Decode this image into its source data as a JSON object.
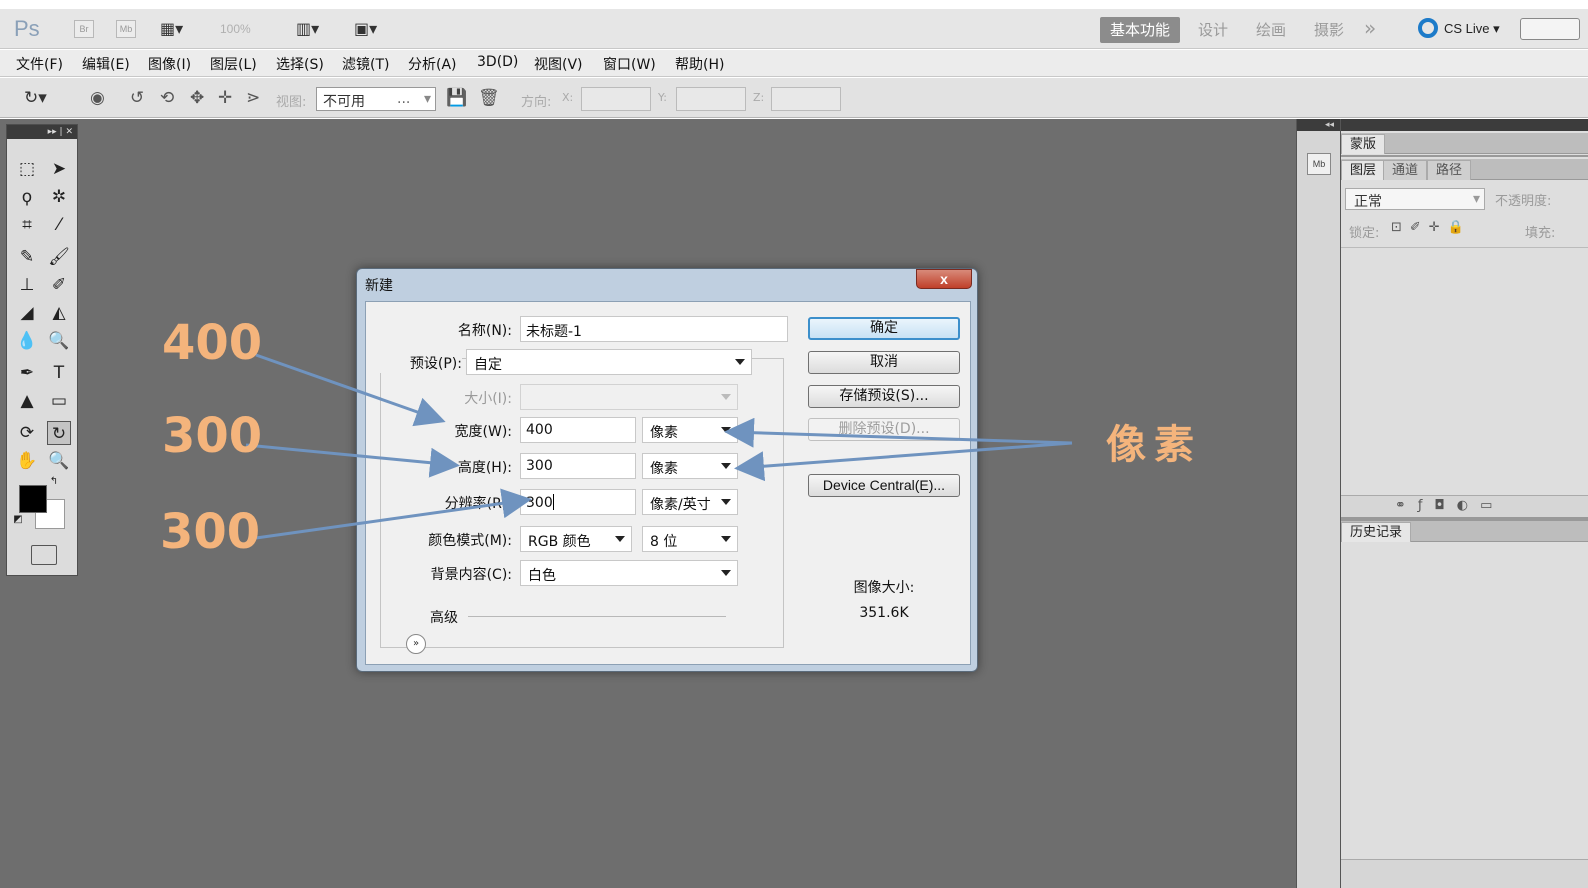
{
  "appbar": {
    "logo": "Ps",
    "bridge": "Br",
    "minibridge": "Mb",
    "zoom": "100%",
    "workspaces": [
      "基本功能",
      "设计",
      "绘画",
      "摄影"
    ],
    "more": "»",
    "cslive": "CS Live"
  },
  "menu": [
    "文件(F)",
    "编辑(E)",
    "图像(I)",
    "图层(L)",
    "选择(S)",
    "滤镜(T)",
    "分析(A)",
    "3D(D)",
    "视图(V)",
    "窗口(W)",
    "帮助(H)"
  ],
  "options": {
    "view_label": "视图:",
    "view_value": "不可用",
    "view_dots": "...",
    "orientation_label": "方向:",
    "x_label": "X:",
    "y_label": "Y:",
    "z_label": "Z:"
  },
  "right_panels": {
    "masks_tab": "蒙版",
    "layers_tabs": [
      "图层",
      "通道",
      "路径"
    ],
    "blend_mode": "正常",
    "opacity_label": "不透明度:",
    "lock_label": "锁定:",
    "fill_label": "填充:",
    "history_tab": "历史记录",
    "mb": "Mb"
  },
  "dialog": {
    "title": "新建",
    "close": "x",
    "name_label": "名称(N):",
    "name_value": "未标题-1",
    "preset_label": "预设(P):",
    "preset_value": "自定",
    "size_label": "大小(I):",
    "width_label": "宽度(W):",
    "width_value": "400",
    "width_unit": "像素",
    "height_label": "高度(H):",
    "height_value": "300",
    "height_unit": "像素",
    "resolution_label": "分辨率(R):",
    "resolution_value": "300",
    "resolution_unit": "像素/英寸",
    "color_mode_label": "颜色模式(M):",
    "color_mode_value": "RGB 颜色",
    "bit_depth": "8 位",
    "background_label": "背景内容(C):",
    "background_value": "白色",
    "advanced_label": "高级",
    "buttons": {
      "ok": "确定",
      "cancel": "取消",
      "save_preset": "存储预设(S)...",
      "delete_preset": "删除预设(D)...",
      "device_central": "Device Central(E)..."
    },
    "image_size_label": "图像大小:",
    "image_size_value": "351.6K"
  },
  "annotations": {
    "width": "400",
    "height": "300",
    "resolution": "300",
    "pixels": "像素",
    "color": "#f4b47c",
    "arrow_color": "#6f93bf"
  }
}
